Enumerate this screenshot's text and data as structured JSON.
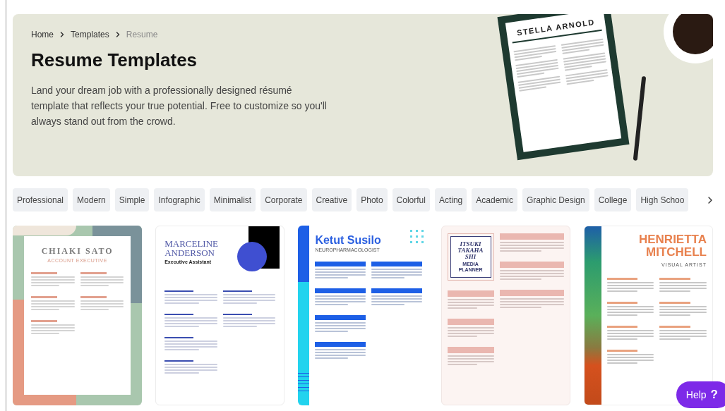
{
  "breadcrumb": [
    {
      "label": "Home",
      "current": false
    },
    {
      "label": "Templates",
      "current": false
    },
    {
      "label": "Resume",
      "current": true
    }
  ],
  "hero": {
    "title": "Resume Templates",
    "description": "Land your dream job with a professionally designed résumé template that reflects your true potential. Free to customize so you'll always stand out from the crowd.",
    "sample_name": "STELLA ARNOLD"
  },
  "tags": [
    "Professional",
    "Modern",
    "Simple",
    "Infographic",
    "Minimalist",
    "Corporate",
    "Creative",
    "Photo",
    "Colorful",
    "Acting",
    "Academic",
    "Graphic Design",
    "College",
    "High Schoo"
  ],
  "templates": [
    {
      "kind": "pastel",
      "name": "CHIAKI SATO",
      "subtitle": "ACCOUNT EXECUTIVE"
    },
    {
      "kind": "corporate",
      "name": "MARCELINE ANDERSON",
      "subtitle": "Executive Assistant"
    },
    {
      "kind": "blue",
      "name": "Ketut Susilo",
      "subtitle": "NEUROPHARMACOLOGIST"
    },
    {
      "kind": "pink",
      "name": "ITSUKI TAKAHA SHI",
      "subtitle": "MEDIA PLANNER"
    },
    {
      "kind": "artist",
      "name": "HENRIETTA MITCHELL",
      "subtitle": "VISUAL ARTIST"
    }
  ],
  "help": {
    "label": "Help",
    "icon_text": "?"
  }
}
